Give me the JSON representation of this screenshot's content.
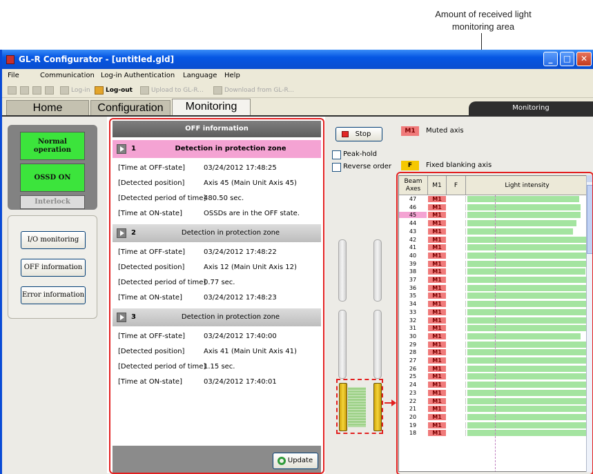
{
  "callout": {
    "line1": "Amount of received light",
    "line2": "monitoring area"
  },
  "window": {
    "title": "GL-R Configurator - [untitled.gld]",
    "min": "_",
    "max": "□",
    "close": "✕"
  },
  "menu": [
    "File",
    "Communication",
    "Log-in Authentication",
    "Language",
    "Help"
  ],
  "toolbar": {
    "login": "Log-in",
    "logout": "Log-out",
    "upload": "Upload to GL-R...",
    "download": "Download from GL-R..."
  },
  "tabs": [
    "Home",
    "Configuration",
    "Monitoring"
  ],
  "mode_label": "Monitoring",
  "status": {
    "normal": "Normal operation",
    "ossd": "OSSD ON",
    "interlock": "Interlock"
  },
  "nav": [
    "I/O monitoring",
    "OFF information",
    "Error information"
  ],
  "off_info": {
    "title": "OFF information",
    "records": [
      {
        "num": "1",
        "title": "Detection in protection zone",
        "rows": [
          [
            "[Time at OFF-state]",
            "03/24/2012 17:48:25"
          ],
          [
            "[Detected position]",
            "Axis 45 (Main Unit Axis 45)"
          ],
          [
            "[Detected period of time]",
            "480.50 sec."
          ],
          [
            "[Time at ON-state]",
            "OSSDs are in the OFF state."
          ]
        ]
      },
      {
        "num": "2",
        "title": "Detection in protection zone",
        "rows": [
          [
            "[Time at OFF-state]",
            "03/24/2012 17:48:22"
          ],
          [
            "[Detected position]",
            "Axis 12 (Main Unit Axis 12)"
          ],
          [
            "[Detected period of time]",
            "0.77 sec."
          ],
          [
            "[Time at ON-state]",
            "03/24/2012 17:48:23"
          ]
        ]
      },
      {
        "num": "3",
        "title": "Detection in protection zone",
        "rows": [
          [
            "[Time at OFF-state]",
            "03/24/2012 17:40:00"
          ],
          [
            "[Detected position]",
            "Axis 41 (Main Unit Axis 41)"
          ],
          [
            "[Detected period of time]",
            "1.15 sec."
          ],
          [
            "[Time at ON-state]",
            "03/24/2012 17:40:01"
          ]
        ]
      }
    ],
    "update": "Update"
  },
  "controls": {
    "stop": "Stop",
    "peak_hold": "Peak-hold",
    "reverse": "Reverse order"
  },
  "legend": {
    "muted_chip": "M1",
    "muted_text": "Muted axis",
    "fixed_chip": "F",
    "fixed_text": "Fixed blanking axis"
  },
  "table": {
    "headers": {
      "beam": "Beam Axes",
      "m": "M1",
      "f": "F",
      "intensity": "Light intensity"
    },
    "selected_axis": "45",
    "rows": [
      {
        "axis": "47",
        "m": "M1",
        "level": 0.93
      },
      {
        "axis": "46",
        "m": "M1",
        "level": 0.94
      },
      {
        "axis": "45",
        "m": "M1",
        "level": 0.94
      },
      {
        "axis": "44",
        "m": "M1",
        "level": 0.91
      },
      {
        "axis": "43",
        "m": "M1",
        "level": 0.88
      },
      {
        "axis": "42",
        "m": "M1",
        "level": 1.0
      },
      {
        "axis": "41",
        "m": "M1",
        "level": 1.0
      },
      {
        "axis": "40",
        "m": "M1",
        "level": 1.0
      },
      {
        "axis": "39",
        "m": "M1",
        "level": 1.0
      },
      {
        "axis": "38",
        "m": "M1",
        "level": 0.98
      },
      {
        "axis": "37",
        "m": "M1",
        "level": 1.0
      },
      {
        "axis": "36",
        "m": "M1",
        "level": 1.0
      },
      {
        "axis": "35",
        "m": "M1",
        "level": 1.0
      },
      {
        "axis": "34",
        "m": "M1",
        "level": 1.0
      },
      {
        "axis": "33",
        "m": "M1",
        "level": 1.0
      },
      {
        "axis": "32",
        "m": "M1",
        "level": 1.0
      },
      {
        "axis": "31",
        "m": "M1",
        "level": 1.0
      },
      {
        "axis": "30",
        "m": "M1",
        "level": 0.94
      },
      {
        "axis": "29",
        "m": "M1",
        "level": 1.0
      },
      {
        "axis": "28",
        "m": "M1",
        "level": 1.0
      },
      {
        "axis": "27",
        "m": "M1",
        "level": 1.0
      },
      {
        "axis": "26",
        "m": "M1",
        "level": 1.0
      },
      {
        "axis": "25",
        "m": "M1",
        "level": 1.0
      },
      {
        "axis": "24",
        "m": "M1",
        "level": 1.0
      },
      {
        "axis": "23",
        "m": "M1",
        "level": 1.0
      },
      {
        "axis": "22",
        "m": "M1",
        "level": 1.0
      },
      {
        "axis": "21",
        "m": "M1",
        "level": 1.0
      },
      {
        "axis": "20",
        "m": "M1",
        "level": 1.0
      },
      {
        "axis": "19",
        "m": "M1",
        "level": 1.0
      },
      {
        "axis": "18",
        "m": "M1",
        "level": 1.0
      }
    ]
  },
  "colors": {
    "accent_red": "#e21f1f",
    "ok_green": "#3ce43c",
    "muted_pink": "#f07a7a",
    "intensity_green": "#a4e4a0"
  }
}
